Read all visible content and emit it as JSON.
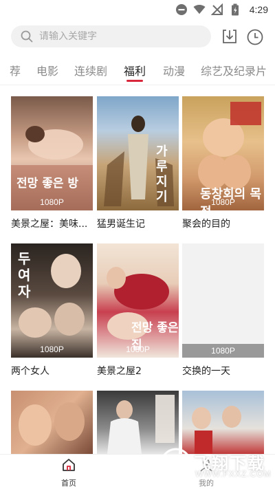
{
  "status_bar": {
    "time": "4:29"
  },
  "search": {
    "placeholder": "请输入关键字"
  },
  "tabs": [
    "荐",
    "电影",
    "连续剧",
    "福利",
    "动漫",
    "综艺及纪录片"
  ],
  "active_tab": "福利",
  "accent_color": "#d8263a",
  "videos": [
    {
      "title": "美景之屋：美味...",
      "quality": "1080P",
      "poster_text": "전망 좋은 방"
    },
    {
      "title": "猛男诞生记",
      "quality": "",
      "poster_text": "가루지기"
    },
    {
      "title": "聚会的目的",
      "quality": "1080P",
      "poster_text": "동창회의 목적"
    },
    {
      "title": "两个女人",
      "quality": "1080P",
      "poster_text": "두여자"
    },
    {
      "title": "美景之屋2",
      "quality": "1080P",
      "poster_text": "전망 좋은 집"
    },
    {
      "title": "交换的一天",
      "quality": "1080P",
      "poster_text": ""
    },
    {
      "title": "",
      "quality": "",
      "poster_text": ""
    },
    {
      "title": "",
      "quality": "",
      "poster_text": ""
    },
    {
      "title": "",
      "quality": "",
      "poster_text": ""
    }
  ],
  "bottom_nav": {
    "home_label": "首页",
    "mine_label": "我的"
  },
  "watermark": {
    "text": "飞翔下载",
    "url": "WWW.FXXZ.COM"
  }
}
